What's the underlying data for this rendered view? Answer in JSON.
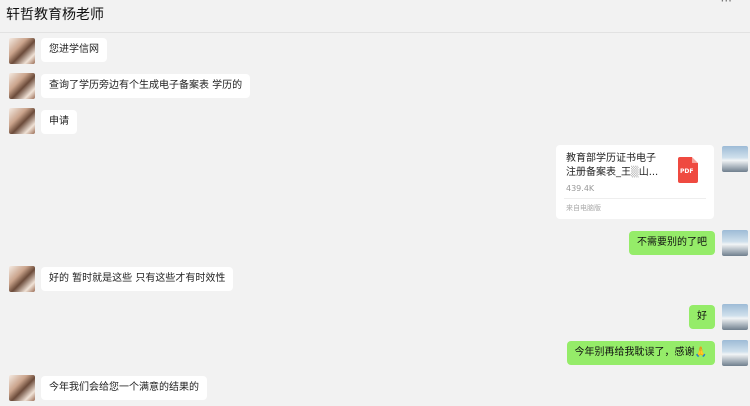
{
  "header": {
    "title": "轩哲教育杨老师",
    "more_glyph": "···"
  },
  "messages": [
    {
      "side": "left",
      "text": "您进学信网"
    },
    {
      "side": "left",
      "text": "查询了学历旁边有个生成电子备案表 学历的"
    },
    {
      "side": "left",
      "text": "申请"
    },
    {
      "side": "right",
      "type": "file",
      "file_name_line1": "教育部学历证书电子",
      "file_name_line2": "注册备案表_王",
      "file_name_suffix": "山...",
      "file_size": "439.4K",
      "file_source": "来自电脑版",
      "file_icon_label": "PDF"
    },
    {
      "side": "right",
      "text": "不需要别的了吧"
    },
    {
      "side": "left",
      "text": "好的 暂时就是这些 只有这些才有时效性"
    },
    {
      "side": "right",
      "text": "好"
    },
    {
      "side": "right",
      "text": "今年别再给我耽误了，感谢",
      "emoji": "🙏"
    },
    {
      "side": "left",
      "text": "今年我们会给您一个满意的结果的"
    }
  ],
  "icons": {
    "avatar_left": "teacher-avatar",
    "avatar_right": "self-avatar",
    "file": "pdf-file-icon"
  }
}
